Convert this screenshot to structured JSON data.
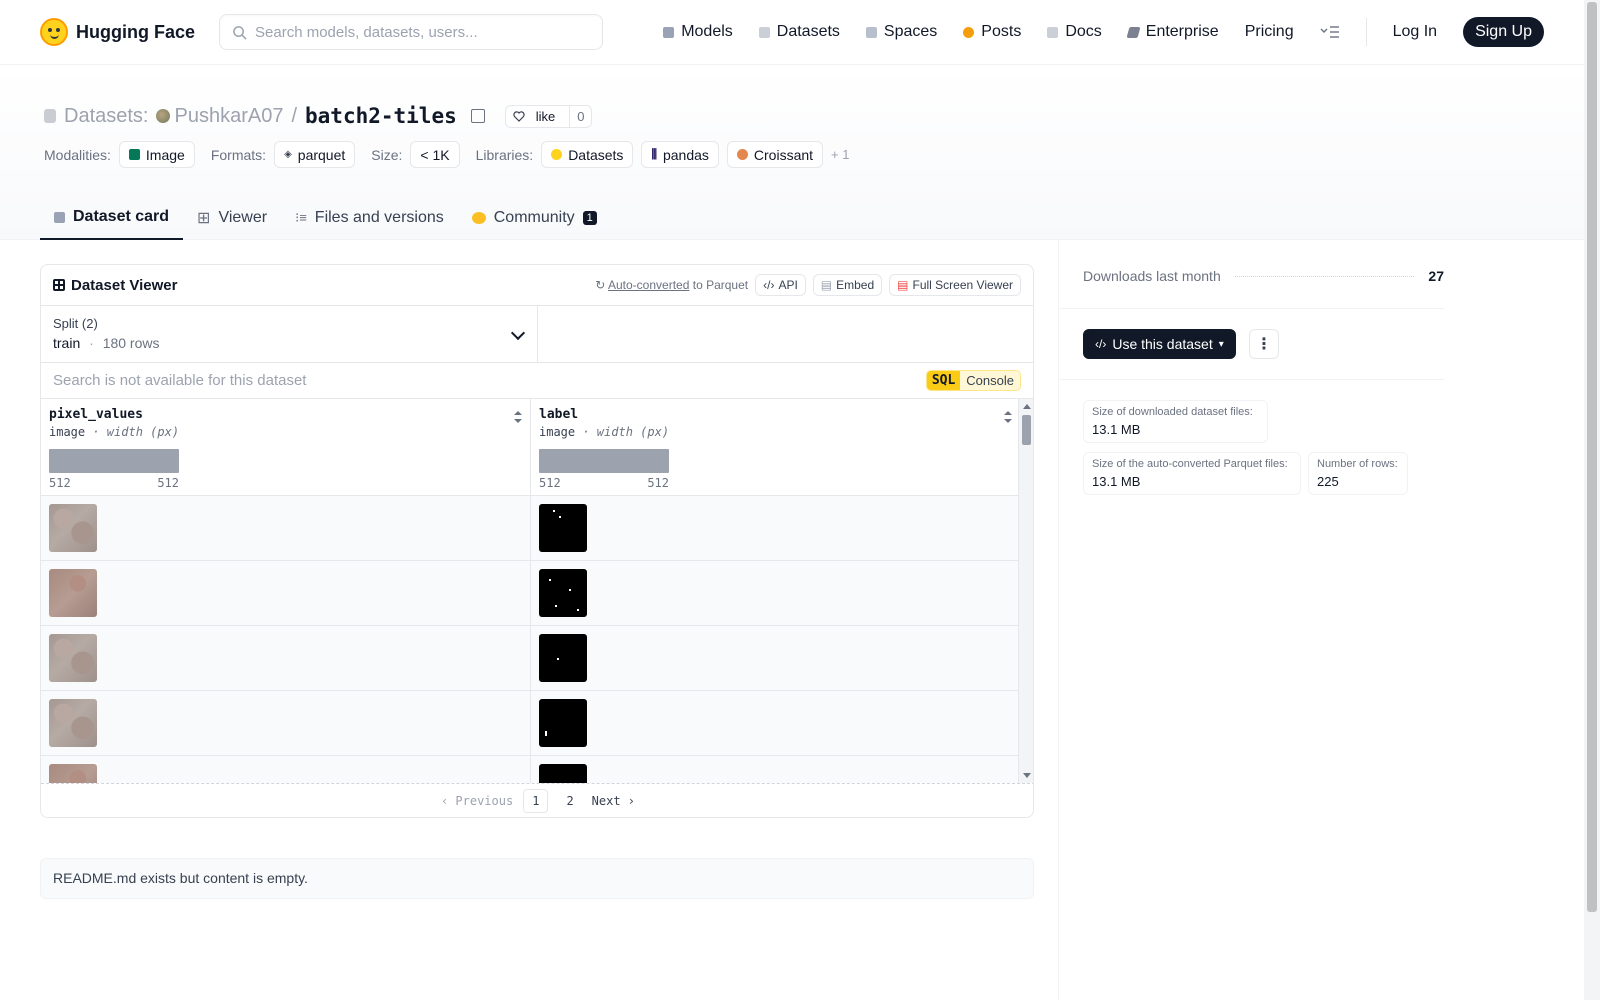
{
  "nav": {
    "brand": "Hugging Face",
    "search_placeholder": "Search models, datasets, users...",
    "links": [
      "Models",
      "Datasets",
      "Spaces",
      "Posts",
      "Docs",
      "Enterprise",
      "Pricing"
    ],
    "login": "Log In",
    "signup": "Sign Up",
    "colors": {
      "models": "#a5b4fc",
      "datasets": "#d1d5db",
      "spaces": "#c7d2fe",
      "posts": "#f59e0b",
      "docs": "#d1d5db",
      "enterprise": "#6b7280"
    }
  },
  "repo": {
    "section": "Datasets:",
    "owner": "PushkarA07",
    "slash": "/",
    "name": "batch2-tiles",
    "like_label": "like",
    "like_count": "0"
  },
  "tags": {
    "modalities_label": "Modalities:",
    "modality": "Image",
    "formats_label": "Formats:",
    "format": "parquet",
    "size_label": "Size:",
    "size": "< 1K",
    "libraries_label": "Libraries:",
    "libraries": [
      "Datasets",
      "pandas",
      "Croissant"
    ],
    "more": "+ 1"
  },
  "tabs": {
    "card": "Dataset card",
    "viewer": "Viewer",
    "files": "Files and versions",
    "community": "Community",
    "community_count": "1"
  },
  "viewer": {
    "title": "Dataset Viewer",
    "auto_converted": "Auto-converted",
    "to_parquet": "to Parquet",
    "api": "API",
    "embed": "Embed",
    "fullscreen": "Full Screen Viewer",
    "split_label": "Split (2)",
    "split_name": "train",
    "split_dot": "·",
    "split_rows": "180 rows",
    "search_note": "Search is not available for this dataset",
    "sql": "SQL",
    "console": "Console",
    "columns": [
      {
        "name": "pixel_values",
        "type": "image",
        "subtype": "· width (px)",
        "min": "512",
        "max": "512"
      },
      {
        "name": "label",
        "type": "image",
        "subtype": "· width (px)",
        "min": "512",
        "max": "512"
      }
    ],
    "pager": {
      "prev": "Previous",
      "p1": "1",
      "p2": "2",
      "next": "Next"
    }
  },
  "readme_note": "README.md exists but content is empty.",
  "sidebar": {
    "downloads_label": "Downloads last month",
    "downloads": "27",
    "use_button": "Use this dataset",
    "more_menu": "⋮",
    "stats": [
      {
        "label": "Size of downloaded dataset files:",
        "value": "13.1 MB"
      },
      {
        "label": "Size of the auto-converted Parquet files:",
        "value": "13.1 MB"
      },
      {
        "label": "Number of rows:",
        "value": "225"
      }
    ]
  }
}
